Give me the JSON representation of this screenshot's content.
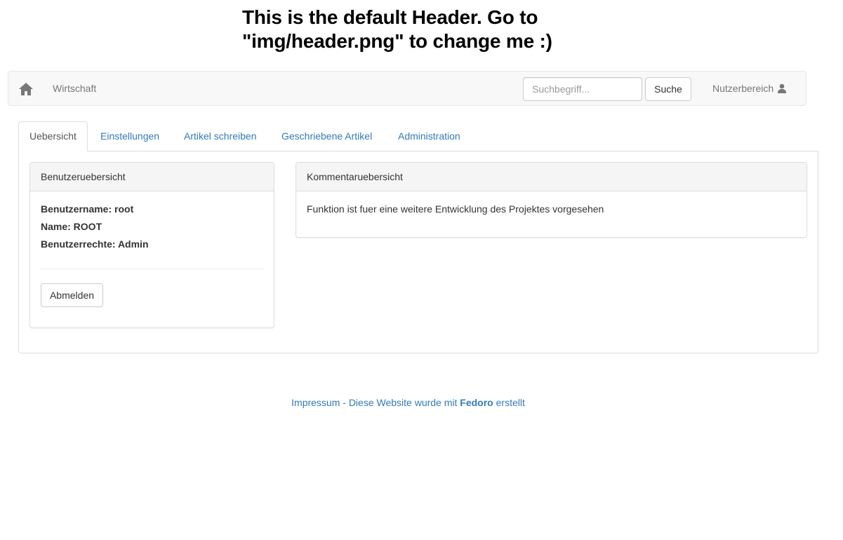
{
  "header_image": {
    "line1": "This is the default Header. Go to",
    "line2": "\"img/header.png\" to change me :)"
  },
  "navbar": {
    "home_icon": "home-icon",
    "brand": "Wirtschaft",
    "search_placeholder": "Suchbegriff...",
    "search_value": "",
    "search_button": "Suche",
    "user_area_label": "Nutzerbereich",
    "user_icon": "user-icon"
  },
  "tabs": [
    {
      "label": "Uebersicht",
      "active": true
    },
    {
      "label": "Einstellungen",
      "active": false
    },
    {
      "label": "Artikel schreiben",
      "active": false
    },
    {
      "label": "Geschriebene Artikel",
      "active": false
    },
    {
      "label": "Administration",
      "active": false
    }
  ],
  "user_panel": {
    "heading": "Benutzeruebersicht",
    "username": "Benutzername: root",
    "name": "Name: ROOT",
    "rights": "Benutzerrechte: Admin",
    "logout_button": "Abmelden"
  },
  "comment_panel": {
    "heading": "Kommentaruebersicht",
    "text": "Funktion ist fuer eine weitere Entwicklung des Projektes vorgesehen"
  },
  "footer": {
    "impressum": "Impressum",
    "middle": " - Diese Website wurde mit ",
    "brand": "Fedoro",
    "end": " erstellt"
  },
  "colors": {
    "link": "#337ab7",
    "navbar_bg": "#f8f8f8",
    "panel_heading_bg": "#f5f5f5",
    "border": "#dddddd"
  }
}
